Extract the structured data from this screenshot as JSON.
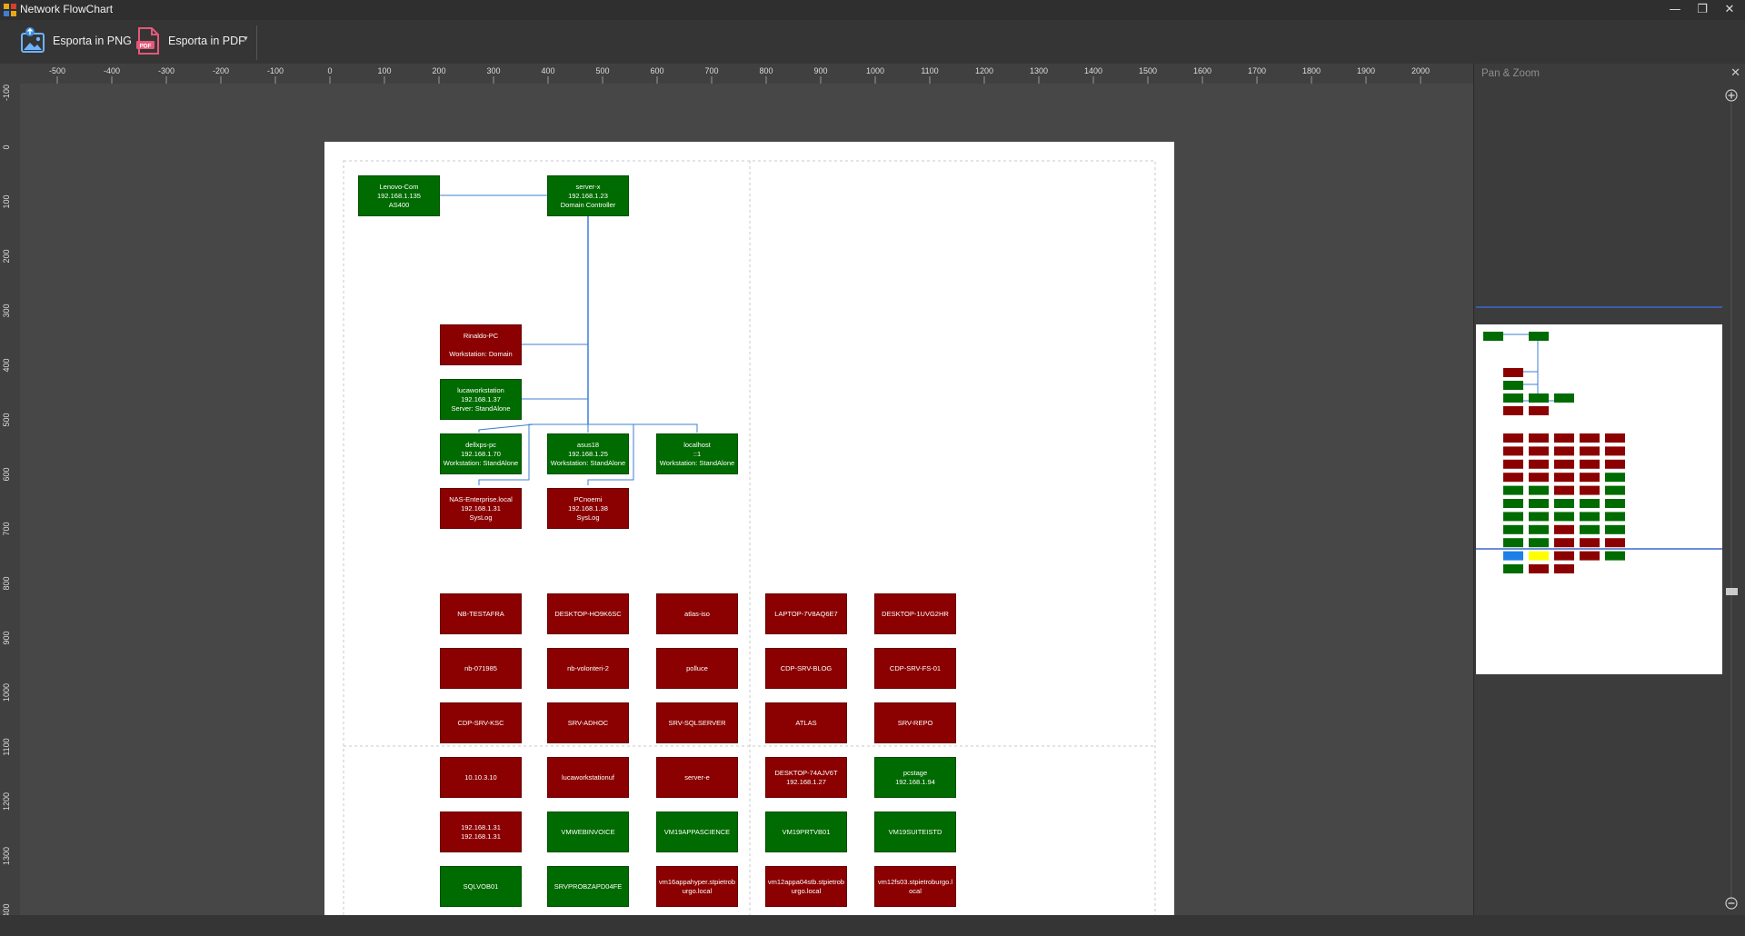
{
  "window": {
    "title": "Network FlowChart",
    "minimize": "—",
    "restore": "❐",
    "close": "✕"
  },
  "toolbar": {
    "export_png": "Esporta in PNG",
    "export_pdf": "Esporta in PDF",
    "dropdown": "▾"
  },
  "ruler": {
    "h_labels": [
      "-500",
      "-400",
      "-300",
      "-200",
      "-100",
      "0",
      "100",
      "200",
      "300",
      "400",
      "500",
      "600",
      "700",
      "800",
      "900",
      "1000",
      "1100",
      "1200",
      "1300",
      "1400",
      "1500",
      "1600",
      "1700",
      "1800",
      "1900",
      "2000"
    ],
    "v_labels": [
      "-100",
      "0",
      "100",
      "200",
      "300",
      "400",
      "500",
      "600",
      "700",
      "800",
      "900",
      "1000",
      "1100",
      "1200",
      "1300",
      "400"
    ]
  },
  "colors": {
    "green": "#006b00",
    "red": "#8b0000",
    "connector": "#3d7fd6",
    "blue": "#1e7fe6",
    "yellow": "#ffff00"
  },
  "nodes": [
    {
      "lines": [
        "Lenovo-Com",
        "192.168.1.135",
        "AS400"
      ],
      "color": "green"
    },
    {
      "lines": [
        "server-x",
        "192.168.1.23",
        "Domain Controller"
      ],
      "color": "green"
    },
    {
      "lines": [
        "Rinaldo-PC",
        "",
        "Workstation: Domain"
      ],
      "color": "red"
    },
    {
      "lines": [
        "lucaworkstation",
        "192.168.1.37",
        "Server: StandAlone"
      ],
      "color": "green"
    },
    {
      "lines": [
        "dellxps-pc",
        "192.168.1.70",
        "Workstation: StandAlone"
      ],
      "color": "green"
    },
    {
      "lines": [
        "asus18",
        "192.168.1.25",
        "Workstation: StandAlone"
      ],
      "color": "green"
    },
    {
      "lines": [
        "localhost",
        "::1",
        "Workstation: StandAlone"
      ],
      "color": "green"
    },
    {
      "lines": [
        "NAS-Enterprise.local",
        "192.168.1.31",
        "SysLog"
      ],
      "color": "red"
    },
    {
      "lines": [
        "PCnoemi",
        "192.168.1.38",
        "SysLog"
      ],
      "color": "red"
    },
    {
      "lines": [
        "NB-TESTAFRA"
      ],
      "color": "red"
    },
    {
      "lines": [
        "DESKTOP-HO9K6SC"
      ],
      "color": "red"
    },
    {
      "lines": [
        "atlas-iso"
      ],
      "color": "red"
    },
    {
      "lines": [
        "LAPTOP-7V8AQ6E7"
      ],
      "color": "red"
    },
    {
      "lines": [
        "DESKTOP-1UVG2HR"
      ],
      "color": "red"
    },
    {
      "lines": [
        "nb-071985"
      ],
      "color": "red"
    },
    {
      "lines": [
        "nb-volonteri-2"
      ],
      "color": "red"
    },
    {
      "lines": [
        "polluce"
      ],
      "color": "red"
    },
    {
      "lines": [
        "CDP-SRV-BLOG"
      ],
      "color": "red"
    },
    {
      "lines": [
        "CDP-SRV-FS-01"
      ],
      "color": "red"
    },
    {
      "lines": [
        "CDP-SRV-KSC"
      ],
      "color": "red"
    },
    {
      "lines": [
        "SRV-ADHOC"
      ],
      "color": "red"
    },
    {
      "lines": [
        "SRV-SQLSERVER"
      ],
      "color": "red"
    },
    {
      "lines": [
        "ATLAS"
      ],
      "color": "red"
    },
    {
      "lines": [
        "SRV-REPO"
      ],
      "color": "red"
    },
    {
      "lines": [
        "10.10.3.10"
      ],
      "color": "red"
    },
    {
      "lines": [
        "lucaworkstationuf"
      ],
      "color": "red"
    },
    {
      "lines": [
        "server-e"
      ],
      "color": "red"
    },
    {
      "lines": [
        "DESKTOP-74AJV6T",
        "192.168.1.27"
      ],
      "color": "red"
    },
    {
      "lines": [
        "pcstage",
        "192.168.1.94"
      ],
      "color": "green"
    },
    {
      "lines": [
        "192.168.1.31",
        "192.168.1.31"
      ],
      "color": "red"
    },
    {
      "lines": [
        "VMWEBINVOICE"
      ],
      "color": "green"
    },
    {
      "lines": [
        "VM19APPASCIENCE"
      ],
      "color": "green"
    },
    {
      "lines": [
        "VM19PRTVB01"
      ],
      "color": "green"
    },
    {
      "lines": [
        "VM19SUITEISTD"
      ],
      "color": "green"
    },
    {
      "lines": [
        "SQLVOB01"
      ],
      "color": "green"
    },
    {
      "lines": [
        "SRVPROBZAPD04FE"
      ],
      "color": "green"
    },
    {
      "lines": [
        "vm16appahyper.stpietrob",
        "urgo.local"
      ],
      "color": "red"
    },
    {
      "lines": [
        "vm12appa04stb.stpietrob",
        "urgo.local"
      ],
      "color": "red"
    },
    {
      "lines": [
        "vm12fs03.stpietroburgo.l",
        "ocal"
      ],
      "color": "red"
    }
  ],
  "pan_zoom": {
    "title": "Pan & Zoom",
    "close": "✕",
    "zoom_in": "+",
    "zoom_out": "−",
    "minimap_colors": [
      "green",
      "green",
      "red",
      "green",
      "green",
      "green",
      "green",
      "red",
      "red",
      "red",
      "red",
      "red",
      "red",
      "red",
      "red",
      "red",
      "red",
      "red",
      "red",
      "red",
      "red",
      "red",
      "red",
      "red",
      "red",
      "red",
      "red",
      "red",
      "green",
      "green",
      "green",
      "red",
      "red",
      "green",
      "green",
      "green",
      "green",
      "green",
      "green",
      "green",
      "green",
      "green",
      "green",
      "green",
      "green",
      "green",
      "red",
      "green",
      "green",
      "green",
      "green",
      "red",
      "red",
      "red",
      "blue",
      "yellow",
      "red",
      "red",
      "green",
      "green",
      "red",
      "red",
      "red"
    ]
  }
}
